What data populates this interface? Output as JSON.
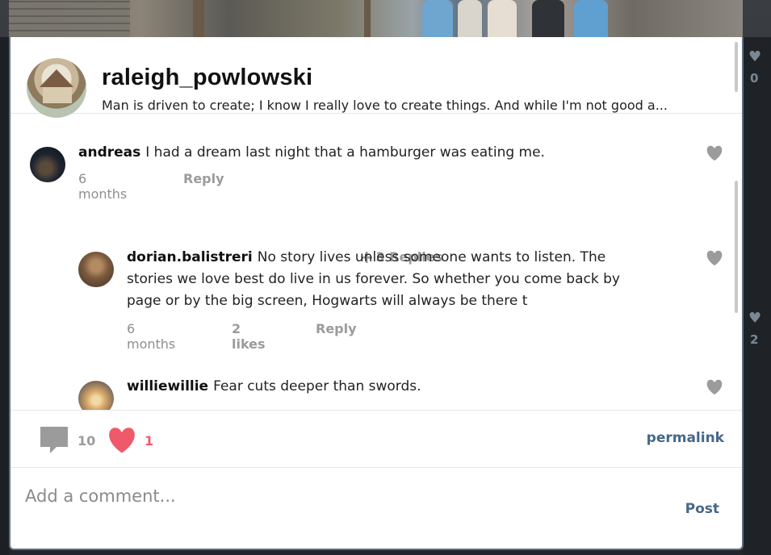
{
  "post": {
    "owner_name": "raleigh_powlowski",
    "owner_bio": "Man is driven to create; I know I really love to create things. And while I'm not good a..."
  },
  "comments": [
    {
      "user": "andreas",
      "text": "I had a dream last night that a hamburger was eating me.",
      "time": "6 months",
      "reply_label": "Reply"
    }
  ],
  "replies_toggle": "3 Replies",
  "replies": [
    {
      "user": "dorian.balistreri",
      "text_line1": "No story lives unless someone wants to listen. The",
      "text_line2": "stories we love best do live in us forever. So whether you come back by",
      "text_line3": "page or by the big screen, Hogwarts will always be there t",
      "time": "6 months",
      "likes": "2 likes",
      "reply_label": "Reply"
    },
    {
      "user": "williewillie",
      "text": "Fear cuts deeper than swords."
    }
  ],
  "actions": {
    "comment_count": "10",
    "like_count": "1",
    "permalink_label": "permalink"
  },
  "composer": {
    "placeholder": "Add a comment...",
    "post_label": "Post"
  },
  "background": {
    "right_count_top": "0",
    "right_count_bottom": "2"
  },
  "colors": {
    "accent": "#46678a",
    "like": "#ef5a6a",
    "muted": "#9b9b9b",
    "border": "#5d7086"
  }
}
